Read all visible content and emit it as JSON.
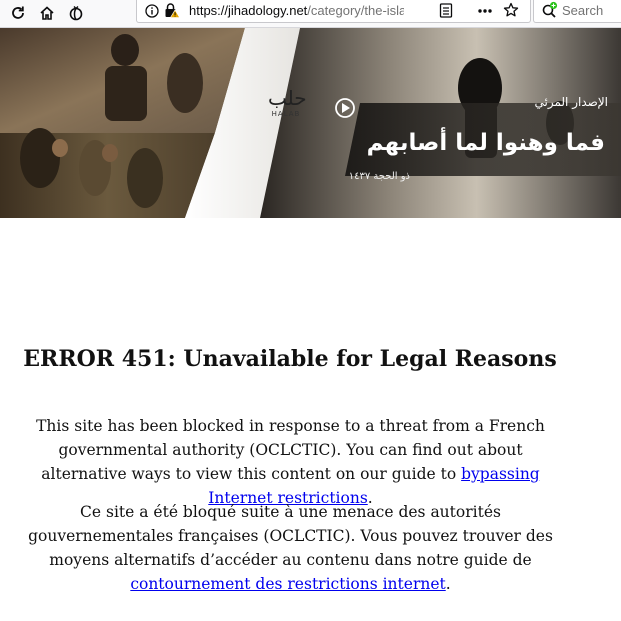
{
  "browser": {
    "url_host": "https://jihadology.net",
    "url_path": "/category/the-isla",
    "search_placeholder": "Search",
    "colors": {
      "toolbar_bg": "#f9f9fa",
      "lock_warning": "#e6a700",
      "addon_green": "#2ac31a"
    }
  },
  "banner": {
    "logo_arabic": "حلب",
    "logo_latin": "HALAB",
    "subtitle": "الإصدار المرئي",
    "title": "فما وهنوا لما أصابهم",
    "date": "ذو الحجة ١٤٣٧"
  },
  "error": {
    "title": "ERROR 451: Unavailable for Legal Reasons",
    "p1_text": "This site has been blocked in response to a threat from a French governmental authority (OCLCTIC). You can find out about alternative ways to view this content on our guide to ",
    "p1_link": "bypassing Internet restrictions",
    "p1_end": ".",
    "p2_text": "Ce site a été bloqué suite à une menace des autorités gouvernementales françaises (OCLCTIC). Vous pouvez trouver des moyens alternatifs d’accéder au contenu dans notre guide de ",
    "p2_link": "contournement des restrictions internet",
    "p2_end": "."
  }
}
